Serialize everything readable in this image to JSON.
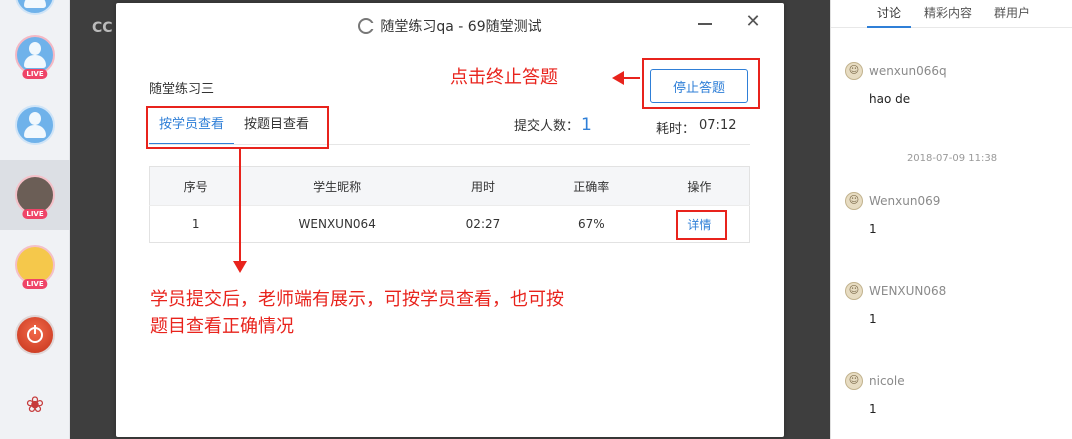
{
  "backdrop": {
    "label": "CC"
  },
  "modal": {
    "title": "随堂练习qa - 69随堂测试",
    "practice_name": "随堂练习三",
    "tabs": [
      {
        "label": "按学员查看",
        "active": true
      },
      {
        "label": "按题目查看",
        "active": false
      }
    ],
    "submit_label": "提交人数：",
    "submit_count": "1",
    "elapsed_label": "耗时：",
    "elapsed_value": "07:12",
    "stop_button": "停止答题",
    "table": {
      "headers": [
        "序号",
        "学生昵称",
        "用时",
        "正确率",
        "操作"
      ],
      "rows": [
        {
          "index": "1",
          "nickname": "WENXUN064",
          "duration": "02:27",
          "accuracy": "67%",
          "action": "详情"
        }
      ]
    }
  },
  "annotations": {
    "stop_hint": "点击终止答题",
    "view_hint_line1": "学员提交后，老师端有展示，可按学员查看，也可按",
    "view_hint_line2": "题目查看正确情况"
  },
  "chat": {
    "tabs": [
      "讨论",
      "精彩内容",
      "群用户"
    ],
    "messages": [
      {
        "name": "wenxun066q",
        "text": "hao de"
      },
      {
        "name": "Wenxun069",
        "text": "1"
      },
      {
        "name": "WENXUN068",
        "text": "1"
      },
      {
        "name": "nicole",
        "text": "1"
      }
    ],
    "timestamp": "2018-07-09  11:38"
  },
  "colors": {
    "accent": "#2f7fd7",
    "annotation": "#e8231c"
  }
}
